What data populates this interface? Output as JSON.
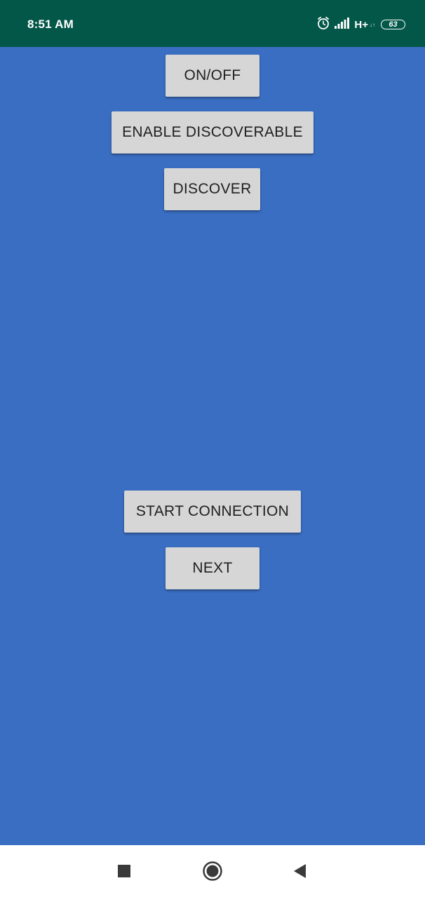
{
  "status_bar": {
    "time": "8:51 AM",
    "network": "H+",
    "network_sub": "↓↑",
    "battery": "63",
    "icons": [
      "alarm-icon",
      "signal-icon",
      "battery-icon"
    ]
  },
  "buttons": {
    "on_off": "ON/OFF",
    "enable_discoverable": "ENABLE DISCOVERABLE",
    "discover": "DISCOVER",
    "start_connection": "START CONNECTION",
    "next": "NEXT"
  },
  "nav_bar": {
    "icons": [
      "recent-apps-icon",
      "home-icon",
      "back-icon"
    ]
  },
  "colors": {
    "status_bar": "#035748",
    "background": "#3a6ec2",
    "button": "#d6d6d6",
    "nav_bar": "#ffffff"
  }
}
